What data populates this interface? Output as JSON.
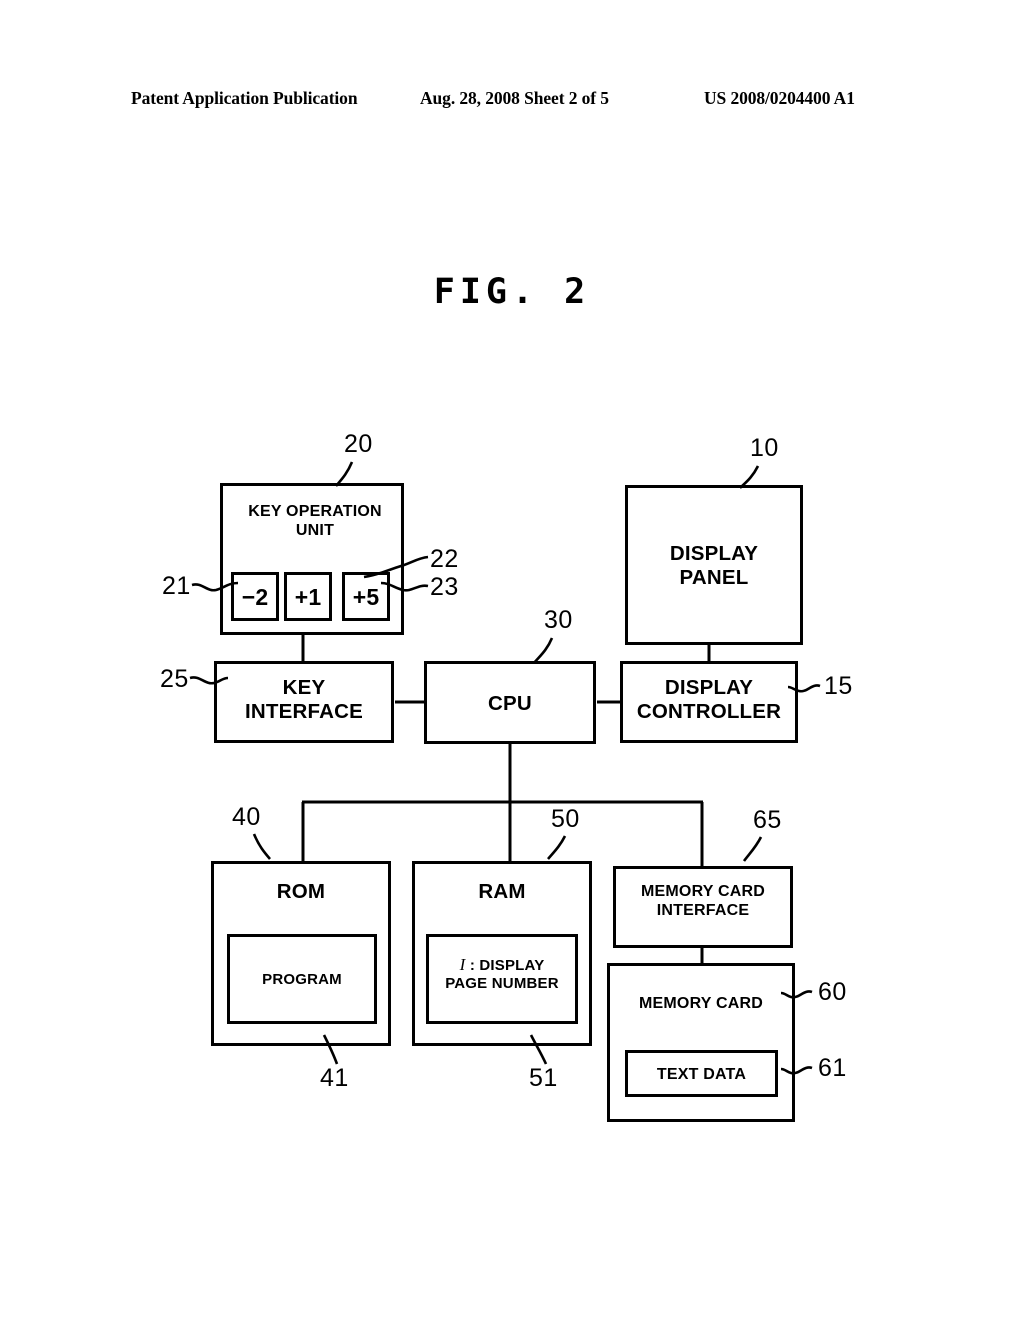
{
  "header": {
    "publication": "Patent Application Publication",
    "date_sheet": "Aug. 28, 2008  Sheet 2 of 5",
    "patent_number": "US 2008/0204400 A1"
  },
  "figure": {
    "title": "FIG. 2",
    "blocks": {
      "key_operation_unit": "KEY OPERATION\nUNIT",
      "key_minus2": "−2",
      "key_plus1": "+1",
      "key_plus5": "+5",
      "display_panel": "DISPLAY\nPANEL",
      "key_interface": "KEY\nINTERFACE",
      "cpu": "CPU",
      "display_controller": "DISPLAY\nCONTROLLER",
      "rom": "ROM",
      "program": "PROGRAM",
      "ram": "RAM",
      "display_page_number_prefix": "I",
      "display_page_number": ": DISPLAY\nPAGE NUMBER",
      "memory_card_interface": "MEMORY CARD\nINTERFACE",
      "memory_card": "MEMORY CARD",
      "text_data": "TEXT DATA"
    },
    "reference_numerals": {
      "key_operation_unit": "20",
      "key_minus2": "21",
      "key_plus1": "22",
      "key_plus5": "23",
      "display_panel": "10",
      "key_interface": "25",
      "cpu": "30",
      "display_controller": "15",
      "rom": "40",
      "program": "41",
      "ram": "50",
      "page_number": "51",
      "memory_card_interface": "65",
      "memory_card": "60",
      "text_data": "61"
    }
  }
}
